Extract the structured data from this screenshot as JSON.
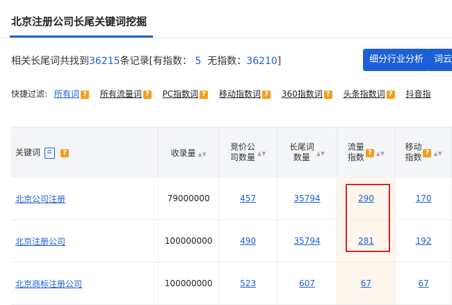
{
  "header": {
    "tab_label": "北京注册公司长尾关键词挖掘"
  },
  "summary": {
    "prefix": "相关长尾词共找到",
    "total": "36215",
    "mid": "条记录[有指数：",
    "with_index": "5",
    "mid2": "无指数：",
    "without_index": "36210",
    "suffix": "]"
  },
  "buttons": {
    "industry": "细分行业分析",
    "wordcloud": "词云分"
  },
  "filters": {
    "label": "快捷过滤:",
    "items": [
      "所有词",
      "所有流量词",
      "PC指数词",
      "移动指数词",
      "360指数词",
      "头条指数词",
      "抖音指"
    ]
  },
  "table": {
    "headers": {
      "keyword": "关键词",
      "records": "收录量",
      "bid_line1": "竞价公",
      "bid_line2": "司数量",
      "longtail_line1": "长尾词",
      "longtail_line2": "数量",
      "traffic_line1": "流量",
      "traffic_line2": "指数",
      "mobile_line1": "移动",
      "mobile_line2": "指数"
    },
    "rows": [
      {
        "keyword": "北京公司注册",
        "records": "79000000",
        "bid": "457",
        "longtail": "35794",
        "traffic": "290",
        "mobile": "170"
      },
      {
        "keyword": "北京注册公司",
        "records": "100000000",
        "bid": "490",
        "longtail": "35794",
        "traffic": "281",
        "mobile": "192"
      },
      {
        "keyword": "北京商标注册公司",
        "records": "100000000",
        "bid": "523",
        "longtail": "607",
        "traffic": "67",
        "mobile": "67"
      }
    ]
  },
  "colors": {
    "accent": "#1d5fd6",
    "help_badge": "#f59d1c",
    "highlight_box": "#e02020"
  }
}
